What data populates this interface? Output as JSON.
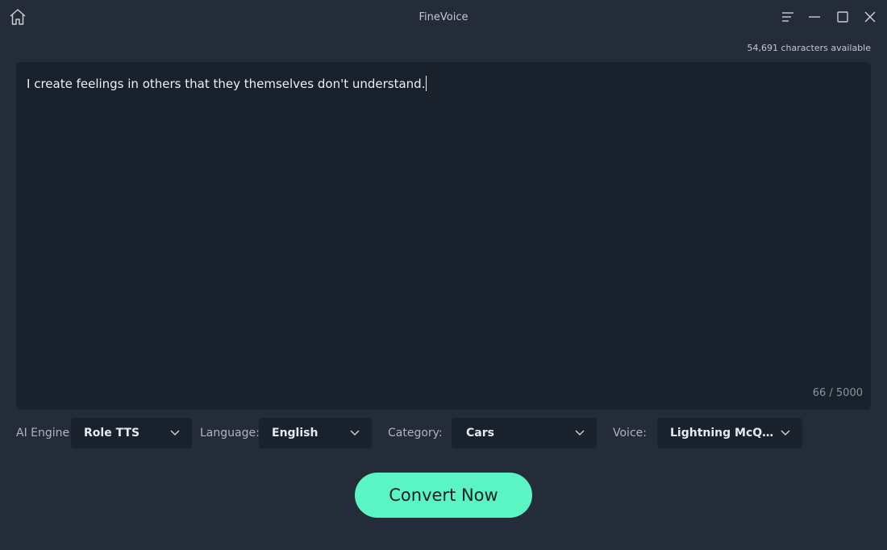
{
  "app": {
    "title": "FineVoice"
  },
  "editor": {
    "chars_available": "54,691 characters available",
    "text": "I create feelings in others that they themselves don't understand.",
    "char_count": "66 / 5000"
  },
  "controls": {
    "ai_engine": {
      "label": "AI Engine",
      "value": "Role TTS"
    },
    "language": {
      "label": "Language:",
      "value": "English"
    },
    "category": {
      "label": "Category:",
      "value": "Cars"
    },
    "voice": {
      "label": "Voice:",
      "value": "Lightning McQuee..."
    }
  },
  "actions": {
    "convert_label": "Convert Now"
  },
  "icons": [
    "home-icon",
    "menu-icon",
    "minimize-icon",
    "maximize-icon",
    "close-icon",
    "chevron-down-icon"
  ],
  "colors": {
    "background": "#232c38",
    "panel": "#19212c",
    "accent": "#5bf5c3"
  }
}
